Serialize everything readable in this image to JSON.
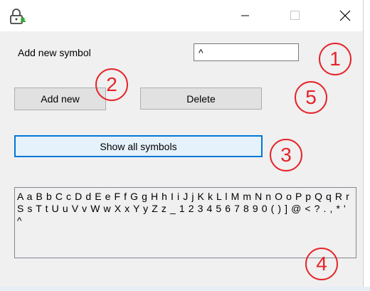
{
  "titlebar": {
    "icons": {
      "app": "lock-key-icon",
      "minimize": "minimize-icon",
      "maximize": "maximize-icon",
      "close": "close-icon"
    }
  },
  "form": {
    "add_new_symbol_label": "Add new symbol",
    "symbol_input_value": "^",
    "add_new_button": "Add new",
    "delete_button": "Delete",
    "show_all_button": "Show all symbols",
    "symbols_text": "A a B b C c D d E e F f G g H h I i J j K k L l M m N n O o P p Q q R r S s T t U u V v W w X x Y y Z z _ 1 2 3 4 5 6 7 8 9 0 ( ) ] @ < ? . , * ' ^"
  },
  "annotations": {
    "n1": "1",
    "n2": "2",
    "n3": "3",
    "n4": "4",
    "n5": "5",
    "color": "#e5242a"
  },
  "colors": {
    "focus_border": "#0078d7",
    "window_bg": "#f0f0f0"
  }
}
